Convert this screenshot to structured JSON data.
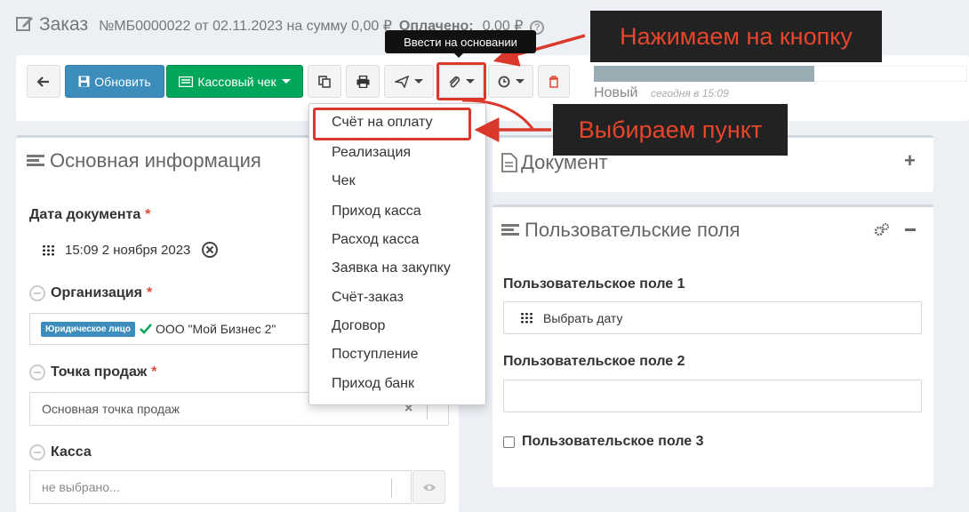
{
  "header": {
    "title": "Заказ",
    "subtitle": "№МБ0000022 от 02.11.2023 на сумму 0,00 ₽",
    "paid_label": "Оплачено:",
    "paid_value": "0,00 ₽"
  },
  "toolbar": {
    "update_label": "Обновить",
    "receipt_label": "Кассовый чек",
    "status_text": "Новый",
    "status_time": "сегодня в 15:09",
    "progress_fraction": 0.59
  },
  "tooltip": "Ввести на основании",
  "callouts": {
    "press_button": "Нажимаем на кнопку",
    "choose_item": "Выбираем пункт"
  },
  "dropdown_items": [
    "Счёт на оплату",
    "Реализация",
    "Чек",
    "Приход касса",
    "Расход касса",
    "Заявка на закупку",
    "Счёт-заказ",
    "Договор",
    "Поступление",
    "Приход банк"
  ],
  "main_info": {
    "title": "Основная информация",
    "date_label": "Дата документа",
    "date_value": "15:09 2 ноября 2023",
    "org_label": "Организация",
    "org_badge": "Юридическое лицо",
    "org_value": "ООО \"Мой Бизнес 2\"",
    "pos_label": "Точка продаж",
    "pos_value": "Основная точка продаж",
    "cash_label": "Касса",
    "cash_placeholder": "не выбрано..."
  },
  "document_panel": {
    "title": "Документ"
  },
  "custom_fields": {
    "title": "Пользовательские поля",
    "field1_label": "Пользовательское поле 1",
    "field1_placeholder": "Выбрать дату",
    "field2_label": "Пользовательское поле 2",
    "field3_label": "Пользовательское поле 3"
  },
  "colors": {
    "blue": "#3c8dbc",
    "green": "#00a65a",
    "red": "#d9382a",
    "callout_text": "#e8452c"
  }
}
